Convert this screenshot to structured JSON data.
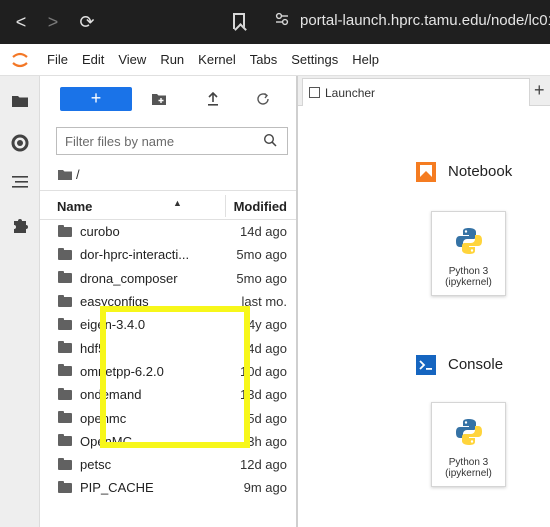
{
  "browser": {
    "back_icon": "<",
    "forward_icon": ">",
    "reload_icon": "⟳",
    "url": "portal-launch.hprc.tamu.edu/node/lc01"
  },
  "menubar": {
    "items": [
      "File",
      "Edit",
      "View",
      "Run",
      "Kernel",
      "Tabs",
      "Settings",
      "Help"
    ]
  },
  "filebrowser": {
    "new_label": "+",
    "filter_placeholder": "Filter files by name",
    "breadcrumb": "/",
    "columns": {
      "name": "Name",
      "modified": "Modified"
    },
    "files": [
      {
        "name": "curobo",
        "modified": "14d ago"
      },
      {
        "name": "dor-hprc-interacti...",
        "modified": "5mo ago"
      },
      {
        "name": "drona_composer",
        "modified": "5mo ago"
      },
      {
        "name": "easyconfigs",
        "modified": "last mo."
      },
      {
        "name": "eigen-3.4.0",
        "modified": "4y ago"
      },
      {
        "name": "hdf5",
        "modified": "4d ago"
      },
      {
        "name": "omnetpp-6.2.0",
        "modified": "10d ago"
      },
      {
        "name": "ondemand",
        "modified": "13d ago"
      },
      {
        "name": "openmc",
        "modified": "5d ago"
      },
      {
        "name": "OpenMC",
        "modified": "3h ago"
      },
      {
        "name": "petsc",
        "modified": "12d ago"
      },
      {
        "name": "PIP_CACHE",
        "modified": "9m ago"
      }
    ]
  },
  "launcher": {
    "tab_label": "Launcher",
    "plus": "+",
    "notebook": {
      "section": "Notebook",
      "card_line1": "Python 3",
      "card_line2": "(ipykernel)"
    },
    "console": {
      "section": "Console",
      "card_line1": "Python 3",
      "card_line2": "(ipykernel)"
    }
  },
  "colors": {
    "browser_bar": "#1f1f1f",
    "accent_blue": "#1a73e8",
    "notebook_orange": "#f57c21",
    "console_blue": "#1565c0",
    "highlight_yellow": "#f7f71a"
  }
}
